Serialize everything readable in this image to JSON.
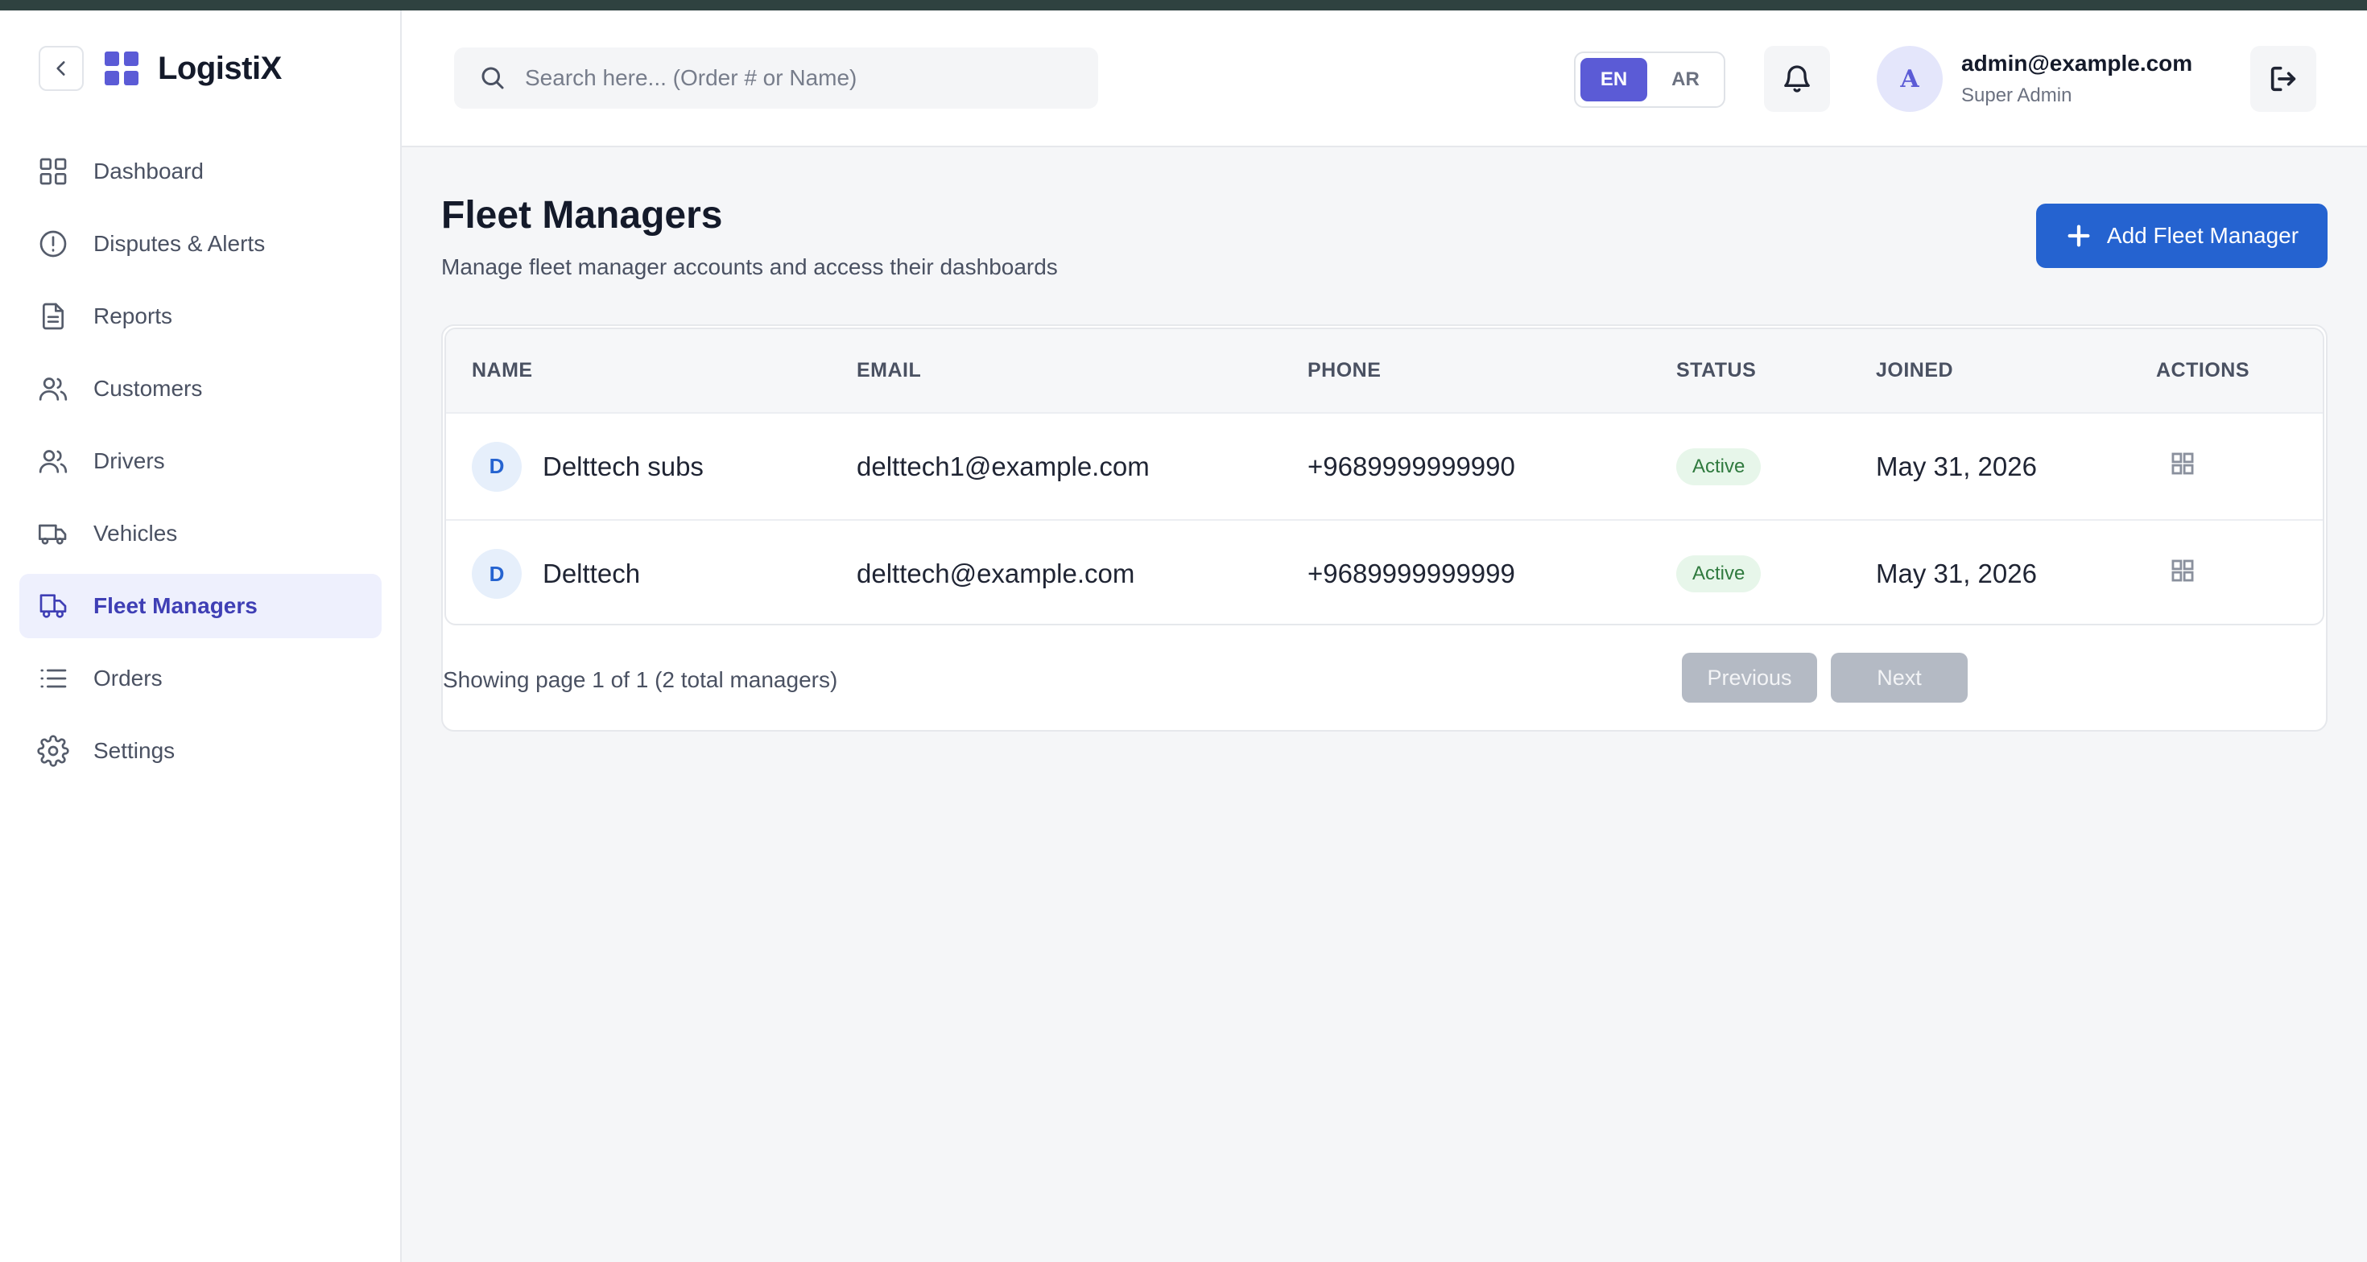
{
  "app": {
    "brand_name": "LogistiX",
    "accent_color": "#5b5bd6",
    "primary_button_color": "#2563d0"
  },
  "sidebar": {
    "items": [
      {
        "label": "Dashboard",
        "icon": "grid-icon",
        "active": false
      },
      {
        "label": "Disputes & Alerts",
        "icon": "alert-circle-icon",
        "active": false
      },
      {
        "label": "Reports",
        "icon": "document-icon",
        "active": false
      },
      {
        "label": "Customers",
        "icon": "users-icon",
        "active": false
      },
      {
        "label": "Drivers",
        "icon": "users-icon",
        "active": false
      },
      {
        "label": "Vehicles",
        "icon": "truck-icon",
        "active": false
      },
      {
        "label": "Fleet Managers",
        "icon": "truck-user-icon",
        "active": true
      },
      {
        "label": "Orders",
        "icon": "list-icon",
        "active": false
      },
      {
        "label": "Settings",
        "icon": "gear-icon",
        "active": false
      }
    ]
  },
  "header": {
    "search_placeholder": "Search here... (Order # or Name)",
    "lang_options": [
      "EN",
      "AR"
    ],
    "lang_selected": "EN",
    "user": {
      "avatar_letter": "A",
      "email": "admin@example.com",
      "role": "Super Admin"
    }
  },
  "page": {
    "title": "Fleet Managers",
    "subtitle": "Manage fleet manager accounts and access their dashboards",
    "add_button_label": "Add Fleet Manager"
  },
  "table": {
    "columns": [
      "NAME",
      "EMAIL",
      "PHONE",
      "STATUS",
      "JOINED",
      "ACTIONS"
    ],
    "rows": [
      {
        "initial": "D",
        "name": "Delttech subs",
        "email": "delttech1@example.com",
        "phone": "+9689999999990",
        "status": "Active",
        "joined": "May 31, 2026"
      },
      {
        "initial": "D",
        "name": "Delttech",
        "email": "delttech@example.com",
        "phone": "+9689999999999",
        "status": "Active",
        "joined": "May 31, 2026"
      }
    ]
  },
  "pagination": {
    "info": "Showing page 1 of 1 (2 total managers)",
    "previous_label": "Previous",
    "next_label": "Next"
  }
}
